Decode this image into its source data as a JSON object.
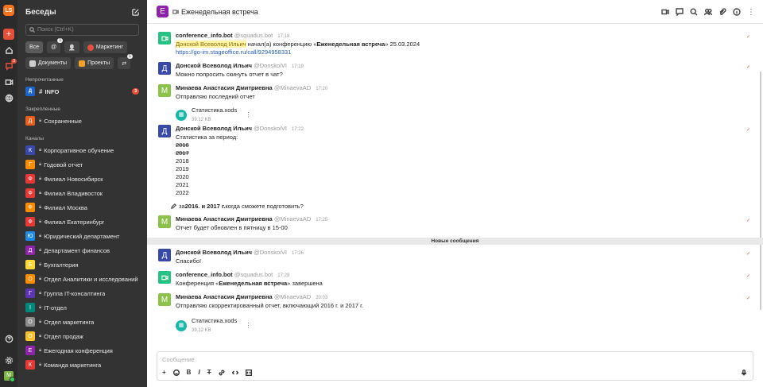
{
  "rail": {
    "logo": "LS",
    "chat_badge": "3",
    "me": "M"
  },
  "sidebar": {
    "title": "Беседы",
    "search_placeholder": "Поиск (Ctrl+K)",
    "filters": [
      {
        "label": "Все",
        "active": true
      },
      {
        "label": "@",
        "count": "1"
      },
      {
        "label": "👤"
      },
      {
        "label": "Маркетинг",
        "color": "#e4503a"
      },
      {
        "label": "Документы",
        "color": "#cfcfcf"
      },
      {
        "label": "Проекты",
        "color": "#f2a227"
      },
      {
        "label": "⇄",
        "count": "1"
      }
    ],
    "section_unread": "Непрочитанные",
    "unread_item": {
      "label": "INFO",
      "badge": "3"
    },
    "section_pinned": "Закрепленные",
    "pinned_item": {
      "label": "Сохраненные",
      "avatar": "Д",
      "color": "#e95e1c"
    },
    "section_channels": "Каналы",
    "channels": [
      {
        "avatar": "К",
        "color": "#3949ab",
        "label": "Корпоративное обучение"
      },
      {
        "avatar": "Г",
        "color": "#fb8c00",
        "label": "Годовой отчет"
      },
      {
        "avatar": "Ф",
        "color": "#e53935",
        "label": "Филиал Новосибирск"
      },
      {
        "avatar": "Ф",
        "color": "#e53935",
        "label": "Филиал Владивосток"
      },
      {
        "avatar": "Ф",
        "color": "#fb8c00",
        "label": "Филиал Москва"
      },
      {
        "avatar": "Ф",
        "color": "#e53935",
        "label": "Филиал Екатеринбург"
      },
      {
        "avatar": "Ю",
        "color": "#1e88e5",
        "label": "Юридический департамент"
      },
      {
        "avatar": "Д",
        "color": "#8e24aa",
        "label": "Департамент финансов"
      },
      {
        "avatar": "Б",
        "color": "#fdd835",
        "label": "Бухгалтерия"
      },
      {
        "avatar": "О",
        "color": "#fb8c00",
        "label": "Отдел Аналитики и исследований"
      },
      {
        "avatar": "Г",
        "color": "#5e35b1",
        "label": "Группа IT-консалтинга"
      },
      {
        "avatar": "I",
        "color": "#00897b",
        "label": "IT-отдел"
      },
      {
        "avatar": "О",
        "color": "#8d8d8d",
        "label": "Отдел маркетинга"
      },
      {
        "avatar": "О",
        "color": "#fbc02d",
        "label": "Отдел продаж"
      },
      {
        "avatar": "Е",
        "color": "#8e24aa",
        "label": "Ежегодная конференция"
      },
      {
        "avatar": "К",
        "color": "#e53935",
        "label": "Команда маркетинга"
      }
    ]
  },
  "header": {
    "avatar": "Е",
    "title": "Еженедельная встреча"
  },
  "messages": {
    "m1": {
      "author": "conference_info.bot",
      "nick": "@squadus.bot",
      "time": "17:18",
      "mention": "Донской Всеволод Ильич",
      "text_a": "начал(а) конференцию «",
      "bold": "Еженедельная встреча",
      "text_b": "» 25.03.2024",
      "link": "https://go-im.stageoffice.ru/call/9294958331"
    },
    "m2": {
      "avatar": "Д",
      "author": "Донской Всеволод Ильич",
      "nick": "@DonskoiVI",
      "time": "17:19",
      "text": "Можно попросить скинуть отчет в чат?"
    },
    "m3": {
      "avatar": "М",
      "author": "Минаева Анастасия Дмитриевна",
      "nick": "@MinaevaAD",
      "time": "17:20",
      "text": "Отправляю последний отчет",
      "file": "Статистика.xods",
      "size": "39.12 KB"
    },
    "m4": {
      "avatar": "Д",
      "author": "Донской Всеволод Ильич",
      "nick": "@DonskoiVI",
      "time": "17:22",
      "text": "Статистика за период:",
      "years_struck": [
        "2016",
        "2017"
      ],
      "years": [
        "2018",
        "2019",
        "2020",
        "2021",
        "2022"
      ]
    },
    "edit": {
      "pre": "за ",
      "bold": "2016. и 2017 г.",
      "post": " когда сможете подготовить?"
    },
    "m5": {
      "avatar": "М",
      "author": "Минаева Анастасия Дмитриевна",
      "nick": "@MinaevaAD",
      "time": "17:25",
      "text": "Отчет будет обновлен в пятницу в 15-00"
    },
    "separator": "Новые сообщения",
    "m6": {
      "avatar": "Д",
      "author": "Донской Всеволод Ильич",
      "nick": "@DonskoiVI",
      "time": "17:26",
      "text": "Спасибо!"
    },
    "m7": {
      "author": "conference_info.bot",
      "nick": "@squadus.bot",
      "time": "17:28",
      "text_a": "Конференция «",
      "bold": "Еженедельная встреча",
      "text_b": "» завершена"
    },
    "m8": {
      "avatar": "М",
      "author": "Минаева Анастасия Дмитриевна",
      "nick": "@MinaevaAD",
      "time": "20:03",
      "text": "Отправляю скорректированный отчет, включающий 2016 г. и 2017 г.",
      "file": "Статистика.xods",
      "size": "39.12 KB"
    }
  },
  "composer": {
    "placeholder": "Сообщение"
  }
}
